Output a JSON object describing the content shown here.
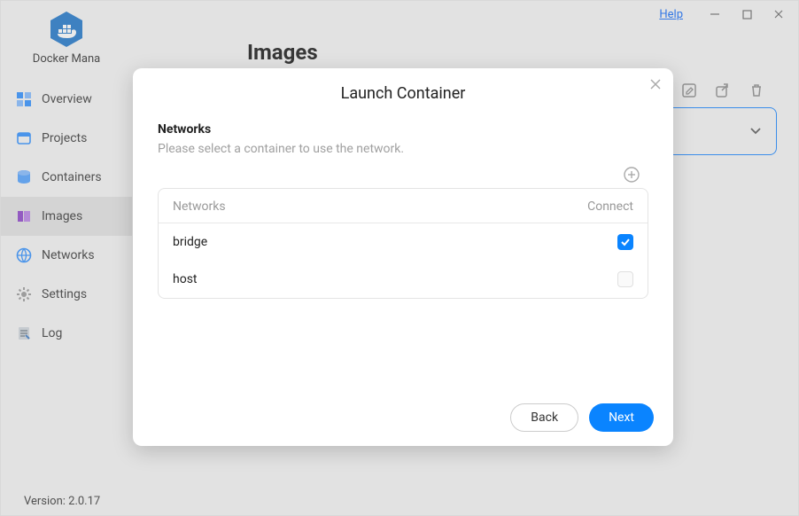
{
  "titlebar": {
    "help": "Help"
  },
  "brand": {
    "name": "Docker Mana"
  },
  "sidebar": {
    "items": [
      {
        "label": "Overview"
      },
      {
        "label": "Projects"
      },
      {
        "label": "Containers"
      },
      {
        "label": "Images"
      },
      {
        "label": "Networks"
      },
      {
        "label": "Settings"
      },
      {
        "label": "Log"
      }
    ]
  },
  "page": {
    "title": "Images"
  },
  "version": "Version: 2.0.17",
  "modal": {
    "title": "Launch Container",
    "section_title": "Networks",
    "section_desc": "Please select a container to use the network.",
    "col_name": "Networks",
    "col_connect": "Connect",
    "rows": [
      {
        "name": "bridge",
        "connected": true
      },
      {
        "name": "host",
        "connected": false
      }
    ],
    "back": "Back",
    "next": "Next"
  }
}
